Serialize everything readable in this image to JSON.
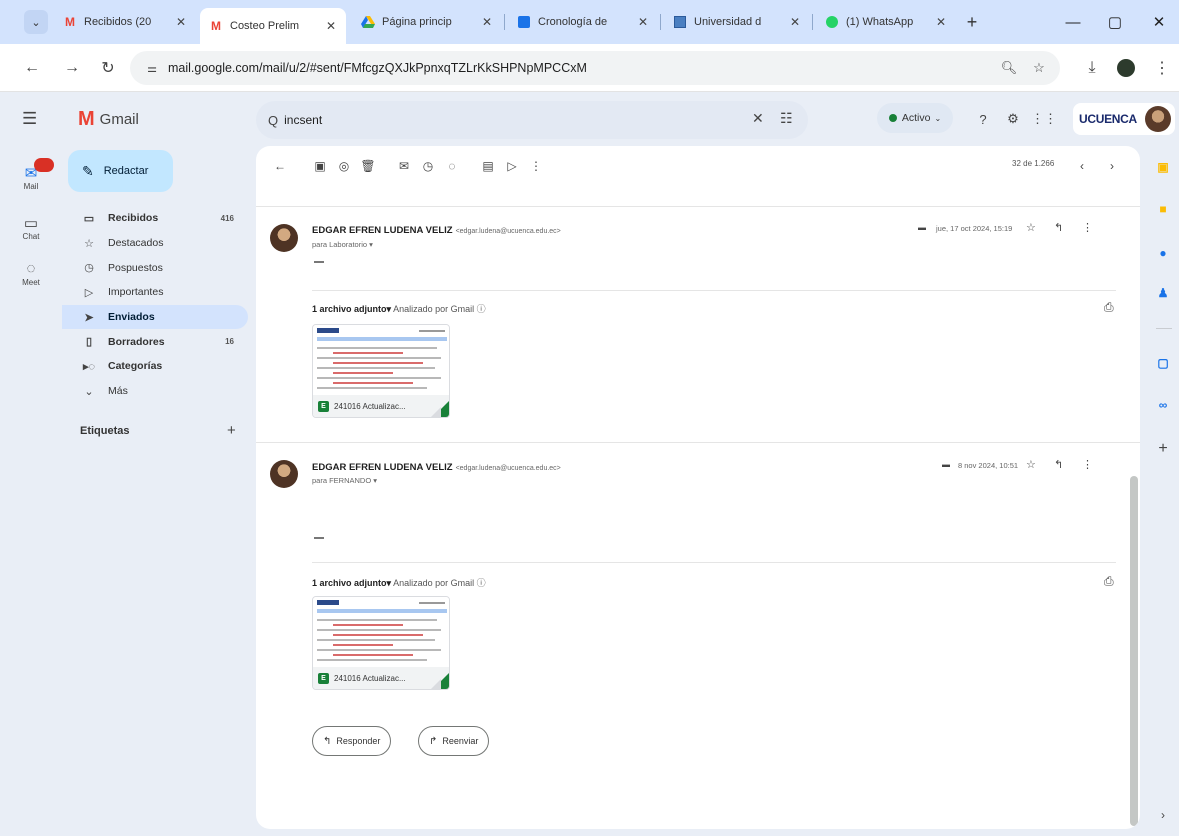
{
  "browser": {
    "tabs": [
      {
        "title": "Recibidos (20",
        "favicon": "gmail-icon",
        "active": false
      },
      {
        "title": "Costeo Prelim",
        "favicon": "gmail-icon",
        "active": true
      },
      {
        "title": "Página princip",
        "favicon": "drive-icon",
        "active": false
      },
      {
        "title": "Cronología de",
        "favicon": "sheets-icon",
        "active": false
      },
      {
        "title": "Universidad d",
        "favicon": "site-icon",
        "active": false
      },
      {
        "title": "(1) WhatsApp",
        "favicon": "whatsapp-icon",
        "active": false
      }
    ],
    "url": "mail.google.com/mail/u/2/#sent/FMfcgzQXJkPpnxqTZLrKkSHPNpMPCCxM"
  },
  "gmail": {
    "app_name": "Gmail",
    "search_value": "incsent",
    "status": "Activo",
    "org_brand": "UCUENCA",
    "compose_label": "Redactar",
    "rail": [
      {
        "label": "Mail",
        "icon": "mail-icon"
      },
      {
        "label": "Chat",
        "icon": "chat-icon"
      },
      {
        "label": "Meet",
        "icon": "meet-icon"
      }
    ],
    "nav": [
      {
        "label": "Recibidos",
        "count": "416",
        "icon": "inbox-icon",
        "bold": true,
        "selected": false
      },
      {
        "label": "Destacados",
        "count": "",
        "icon": "star-icon",
        "bold": false,
        "selected": false
      },
      {
        "label": "Pospuestos",
        "count": "",
        "icon": "clock-icon",
        "bold": false,
        "selected": false
      },
      {
        "label": "Importantes",
        "count": "",
        "icon": "important-icon",
        "bold": false,
        "selected": false
      },
      {
        "label": "Enviados",
        "count": "",
        "icon": "send-icon",
        "bold": true,
        "selected": true
      },
      {
        "label": "Borradores",
        "count": "16",
        "icon": "draft-icon",
        "bold": true,
        "selected": false
      },
      {
        "label": "Categorías",
        "count": "",
        "icon": "label-icon",
        "bold": true,
        "selected": false
      },
      {
        "label": "Más",
        "count": "",
        "icon": "chevron-down-icon",
        "bold": false,
        "selected": false
      }
    ],
    "labels_heading": "Etiquetas",
    "pagination": "32 de 1.266"
  },
  "messages": [
    {
      "sender": "EDGAR EFREN LUDENA VELIZ",
      "email": "<edgar.ludena@ucuenca.edu.ec>",
      "recipient": "para Laboratorio",
      "date": "jue, 17 oct 2024, 15:19",
      "attachment_header": "1 archivo adjunto",
      "scanned": "Analizado por Gmail",
      "attachment_name": "241016 Actualizac..."
    },
    {
      "sender": "EDGAR EFREN LUDENA VELIZ",
      "email": "<edgar.ludena@ucuenca.edu.ec>",
      "recipient": "para FERNANDO",
      "date": "8 nov 2024, 10:51",
      "attachment_header": "1 archivo adjunto",
      "scanned": "Analizado por Gmail",
      "attachment_name": "241016 Actualizac..."
    }
  ],
  "actions": {
    "reply": "Responder",
    "forward": "Reenviar"
  },
  "colors": {
    "accent": "#c2e7ff",
    "selected_nav": "#d3e3fd",
    "sheets_green": "#188038",
    "gmail_red": "#ea4335"
  }
}
